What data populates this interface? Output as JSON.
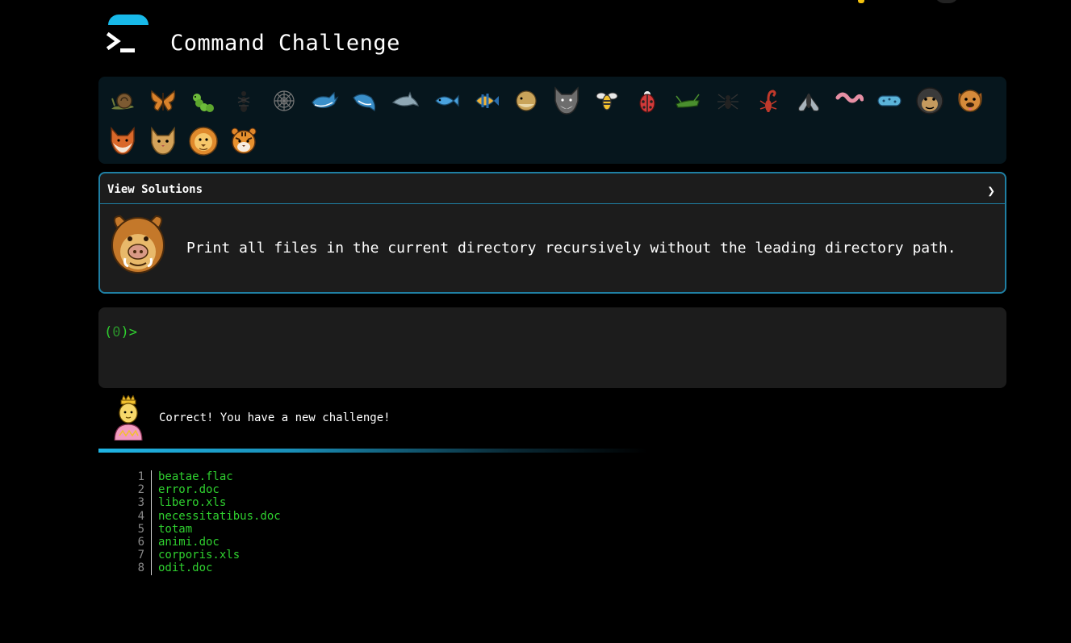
{
  "header": {
    "title": "Command Challenge"
  },
  "animals": [
    "snail-icon",
    "butterfly-icon",
    "caterpillar-icon",
    "ant-icon",
    "spider-web-icon",
    "whale-icon",
    "spouting-whale-icon",
    "dolphin-icon",
    "fish-icon",
    "tropical-fish-icon",
    "blowfish-icon",
    "wolf-icon",
    "bee-icon",
    "ladybug-icon",
    "cricket-icon",
    "spider-icon",
    "scorpion-icon",
    "fly-icon",
    "worm-icon",
    "microbe-icon",
    "gorilla-icon",
    "dog-icon",
    "fox-icon",
    "cat-icon",
    "lion-icon",
    "tiger-icon"
  ],
  "challenge": {
    "view_solutions_label": "View Solutions",
    "chevron": "❯",
    "description": "Print all files in the current directory recursively without the leading directory path.",
    "avatar": "boar-icon"
  },
  "terminal": {
    "prompt_open": "(",
    "exit_code": "0",
    "prompt_close": ")>"
  },
  "feedback": {
    "avatar": "princess-icon",
    "message": "Correct! You have a new challenge!"
  },
  "colors": {
    "accent": "#18b9e9",
    "terminal_green": "#2fd12f",
    "card_border": "#1f7fa3"
  },
  "output": [
    {
      "n": "1",
      "file": "beatae.flac"
    },
    {
      "n": "2",
      "file": "error.doc"
    },
    {
      "n": "3",
      "file": "libero.xls"
    },
    {
      "n": "4",
      "file": "necessitatibus.doc"
    },
    {
      "n": "5",
      "file": "totam"
    },
    {
      "n": "6",
      "file": "animi.doc"
    },
    {
      "n": "7",
      "file": "corporis.xls"
    },
    {
      "n": "8",
      "file": "odit.doc"
    }
  ]
}
